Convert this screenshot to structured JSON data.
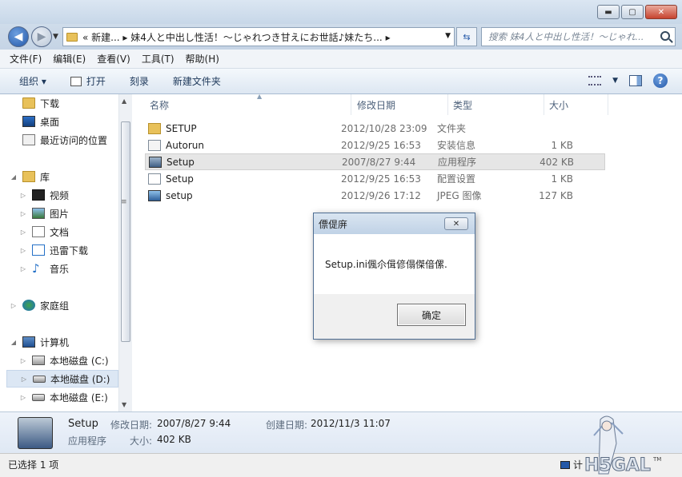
{
  "window": {
    "minimize_glyph": "▬",
    "maximize_glyph": "▢",
    "close_glyph": "✕"
  },
  "address": {
    "path_text": "« 新建... ▸ 妹4人と中出し性活！～じゃれつき甘えにお世話♪妹たち... ▸",
    "search_placeholder": "搜索 妹4人と中出し性活！～じゃれ..."
  },
  "menu": [
    "文件(F)",
    "编辑(E)",
    "查看(V)",
    "工具(T)",
    "帮助(H)"
  ],
  "toolbar": {
    "organize": "组织 ▾",
    "open": "打开",
    "burn": "刻录",
    "new_folder": "新建文件夹"
  },
  "nav": {
    "downloads": "下载",
    "desktop": "桌面",
    "recent": "最近访问的位置",
    "libraries": "库",
    "videos": "视频",
    "pictures": "图片",
    "documents": "文档",
    "xunlei": "迅雷下载",
    "music": "音乐",
    "homegroup": "家庭组",
    "computer": "计算机",
    "drive_c": "本地磁盘 (C:)",
    "drive_d": "本地磁盘 (D:)",
    "drive_e": "本地磁盘 (E:)"
  },
  "columns": {
    "name": "名称",
    "date": "修改日期",
    "type": "类型",
    "size": "大小"
  },
  "files": [
    {
      "name": "SETUP",
      "date": "2012/10/28 23:09",
      "type": "文件夹",
      "size": "",
      "icon": "folder-icon"
    },
    {
      "name": "Autorun",
      "date": "2012/9/25 16:53",
      "type": "安装信息",
      "size": "1 KB",
      "icon": "inf-file-icon"
    },
    {
      "name": "Setup",
      "date": "2007/8/27 9:44",
      "type": "应用程序",
      "size": "402 KB",
      "icon": "exe-file-icon"
    },
    {
      "name": "Setup",
      "date": "2012/9/25 16:53",
      "type": "配置设置",
      "size": "1 KB",
      "icon": "ini-file-icon"
    },
    {
      "name": "setup",
      "date": "2012/9/26 17:12",
      "type": "JPEG 图像",
      "size": "127 KB",
      "icon": "jpeg-file-icon"
    }
  ],
  "dialog": {
    "title": "僄偍庰",
    "message": "Setup.ini偑尒偮偐傝傑偣傫.",
    "ok": "确定",
    "close_glyph": "✕"
  },
  "details": {
    "name": "Setup",
    "type": "应用程序",
    "modified_label": "修改日期:",
    "modified_value": "2007/8/27 9:44",
    "size_label": "大小:",
    "size_value": "402 KB",
    "created_label": "创建日期:",
    "created_value": "2012/11/3 11:07"
  },
  "status": {
    "selected": "已选择 1 项",
    "computer": "计"
  },
  "watermark": {
    "logo_text": "H5GAL",
    "tm": "TM"
  },
  "colors": {
    "accent": "#2458a8",
    "selection": "#dce7f4"
  }
}
